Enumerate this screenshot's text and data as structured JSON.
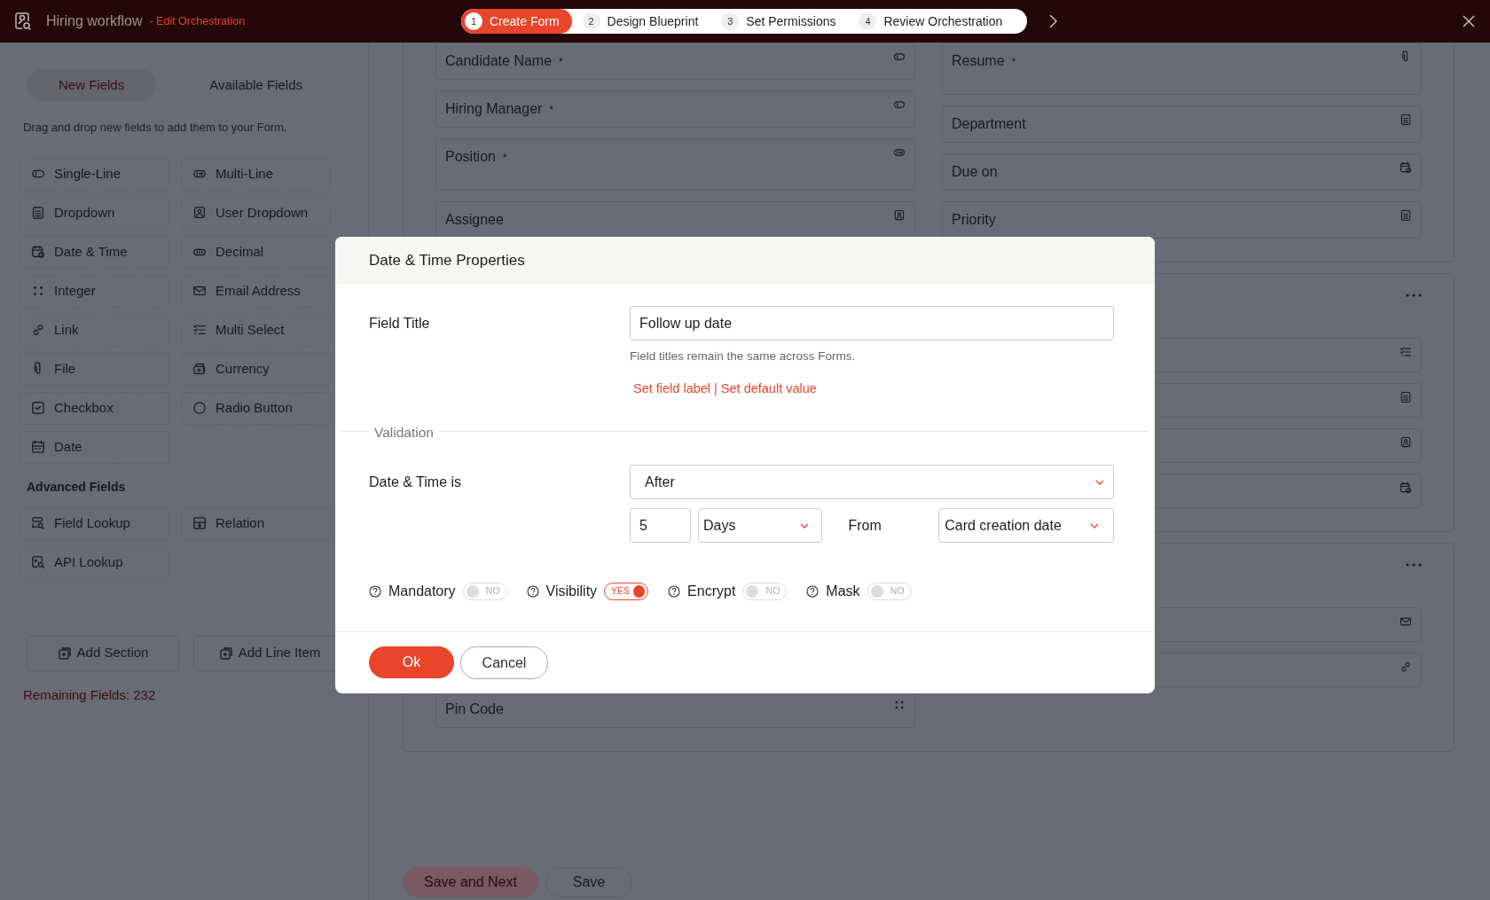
{
  "header": {
    "title": "Hiring workflow",
    "subtitle": "- Edit Orchestration"
  },
  "steps": [
    {
      "number": "1",
      "label": "Create Form",
      "selected": true
    },
    {
      "number": "2",
      "label": "Design Blueprint",
      "selected": false
    },
    {
      "number": "3",
      "label": "Set Permissions",
      "selected": false
    },
    {
      "number": "4",
      "label": "Review Orchestration",
      "selected": false
    }
  ],
  "palette": {
    "tabs": [
      {
        "label": "New Fields",
        "selected": true
      },
      {
        "label": "Available Fields",
        "selected": false
      }
    ],
    "hint": "Drag and drop new fields to add them to your Form.",
    "fields": [
      {
        "label": "Single-Line",
        "kind": "single-line"
      },
      {
        "label": "Multi-Line",
        "kind": "multi-line"
      },
      {
        "label": "Dropdown",
        "kind": "dropdown"
      },
      {
        "label": "User Dropdown",
        "kind": "user"
      },
      {
        "label": "Date & Time",
        "kind": "date-time"
      },
      {
        "label": "Decimal",
        "kind": "decimal"
      },
      {
        "label": "Integer",
        "kind": "integer"
      },
      {
        "label": "Email Address",
        "kind": "email"
      },
      {
        "label": "Link",
        "kind": "link"
      },
      {
        "label": "Multi Select",
        "kind": "multi-select"
      },
      {
        "label": "File",
        "kind": "file"
      },
      {
        "label": "Currency",
        "kind": "currency"
      },
      {
        "label": "Checkbox",
        "kind": "checkbox"
      },
      {
        "label": "Radio Button",
        "kind": "radio"
      },
      {
        "label": "Date",
        "kind": "date"
      }
    ],
    "advanced_title": "Advanced Fields",
    "advanced_fields": [
      {
        "label": "Field Lookup",
        "kind": "lookup"
      },
      {
        "label": "Relation",
        "kind": "relation"
      },
      {
        "label": "API Lookup",
        "kind": "api"
      }
    ],
    "actions": [
      "Add Section",
      "Add Line Item"
    ],
    "remaining": "Remaining Fields: 232"
  },
  "form_sections": [
    {
      "left": [
        {
          "label": "Candidate Name",
          "mark": "*",
          "kind": "single-line"
        },
        {
          "label": "Hiring Manager",
          "mark": "*",
          "kind": "single-line"
        },
        {
          "label": "Position",
          "mark": "*",
          "kind": "multi-line"
        },
        {
          "label": "Assignee",
          "kind": "user"
        }
      ],
      "right": [
        {
          "label": "Resume",
          "mark": "*",
          "kind": "file"
        },
        {
          "label": "Department",
          "kind": "dropdown"
        },
        {
          "label": "Due on",
          "kind": "date-time"
        },
        {
          "label": "Priority",
          "kind": "dropdown"
        }
      ]
    },
    {
      "menu": true,
      "right": [
        {
          "kind": "multi-select"
        },
        {
          "kind": "dropdown"
        },
        {
          "kind": "user"
        },
        {
          "kind": "date-time"
        }
      ]
    },
    {
      "menu": true,
      "left": [
        {
          "label": "Pin Code",
          "kind": "integer"
        }
      ],
      "right": [
        {
          "kind": "email"
        },
        {
          "kind": "link"
        }
      ]
    }
  ],
  "footer_buttons": [
    "Save and Next",
    "Save"
  ],
  "modal": {
    "title": "Date & Time Properties",
    "field_title": {
      "label": "Field Title",
      "value": "Follow up date",
      "help": "Field titles remain the same across Forms."
    },
    "links": [
      "Set field label",
      "Set default value"
    ],
    "link_separator": "|",
    "validation": "Validation",
    "condition": {
      "label": "Date & Time is",
      "value": "After"
    },
    "amount": "5",
    "unit": "Days",
    "from_label": "From",
    "from_value": "Card creation date",
    "toggles": [
      {
        "label": "Mandatory",
        "on": false,
        "state_text": "NO"
      },
      {
        "label": "Visibility",
        "on": true,
        "state_text": "YES"
      },
      {
        "label": "Encrypt",
        "on": false,
        "state_text": "NO"
      },
      {
        "label": "Mask",
        "on": false,
        "state_text": "NO"
      }
    ],
    "ok": "Ok",
    "cancel": "Cancel"
  }
}
